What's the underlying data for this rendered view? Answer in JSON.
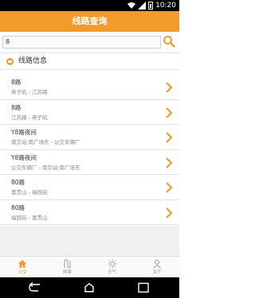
{
  "status_bar": {
    "time": "10:20"
  },
  "header": {
    "title": "线路查询"
  },
  "search": {
    "value": "8"
  },
  "section": {
    "title": "线路信息"
  },
  "results": [
    {
      "name": "8路",
      "route": "燕子矶 - 江苏路"
    },
    {
      "name": "8路",
      "route": "江苏路 - 燕子矶"
    },
    {
      "name": "Y8路夜间",
      "route": "南京站·南广场东 - 公交车辆厂"
    },
    {
      "name": "Y8路夜间",
      "route": "公交车辆厂 - 南京站·南广场东"
    },
    {
      "name": "80路",
      "route": "富贵山 - 福园街"
    },
    {
      "name": "80路",
      "route": "福园街 - 富贵山"
    }
  ],
  "tabs": [
    {
      "label": "公交",
      "icon": "home-icon",
      "active": true
    },
    {
      "label": "换乘",
      "icon": "transfer-icon",
      "active": false
    },
    {
      "label": "天气",
      "icon": "sun-icon",
      "active": false
    },
    {
      "label": "关于",
      "icon": "person-icon",
      "active": false
    }
  ],
  "colors": {
    "accent": "#f39a2c",
    "background": "#f0f0f0"
  }
}
